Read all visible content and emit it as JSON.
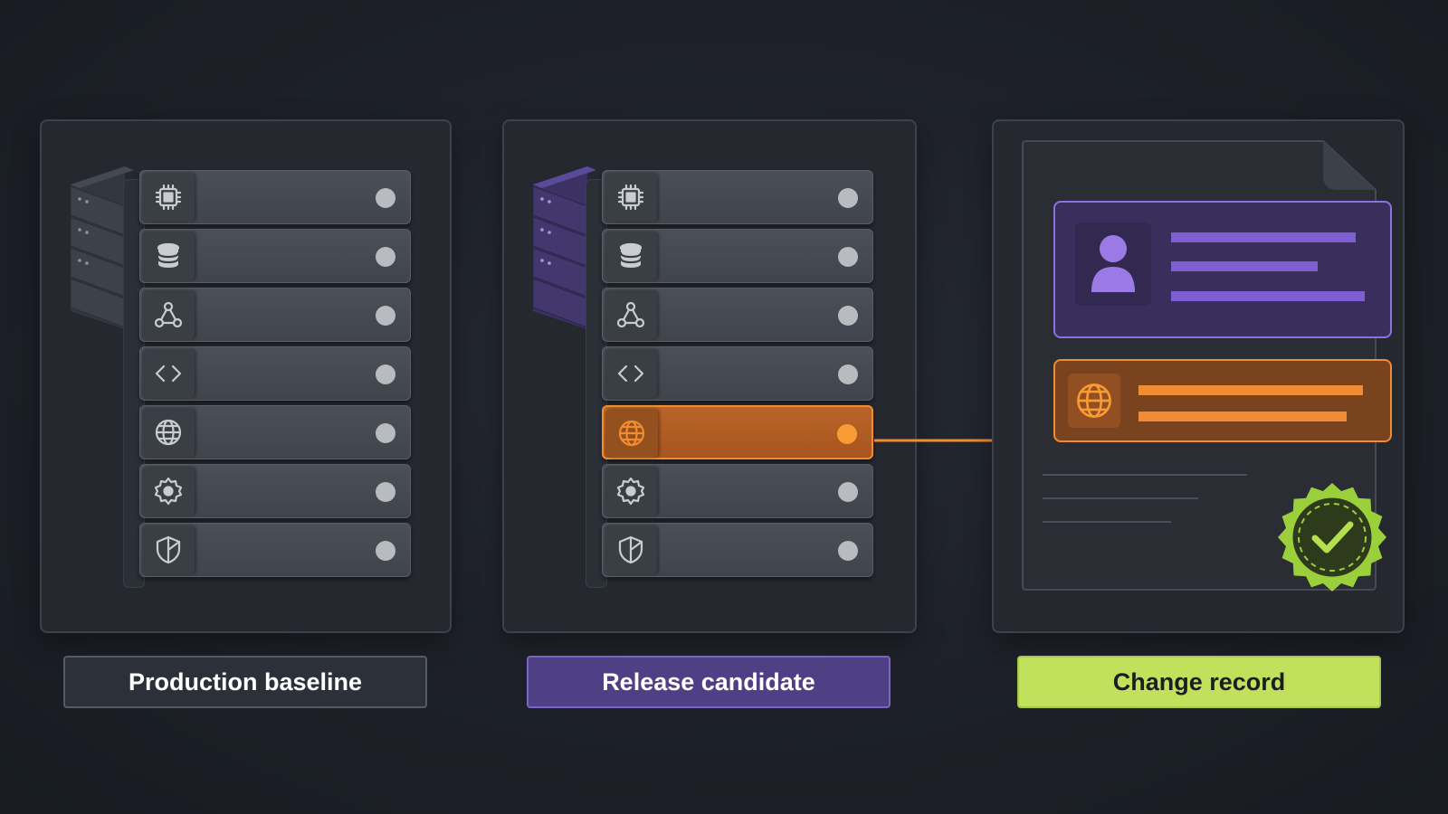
{
  "captions": {
    "baseline": "Production baseline",
    "candidate": "Release candidate",
    "record": "Change record"
  },
  "rack_rows": [
    {
      "icon": "cpu-icon"
    },
    {
      "icon": "database-icon"
    },
    {
      "icon": "network-icon"
    },
    {
      "icon": "code-icon"
    },
    {
      "icon": "globe-icon"
    },
    {
      "icon": "gear-icon"
    },
    {
      "icon": "shield-icon"
    }
  ],
  "candidate_changed_row": "globe-icon",
  "record_icons": {
    "person": "person-icon",
    "network": "globe-icon",
    "seal": "approved-seal-icon"
  },
  "colors": {
    "accent_purple": "#8b72e0",
    "accent_orange": "#f08c32",
    "accent_green": "#c1e05c",
    "led_default": "#b8bbc0"
  }
}
